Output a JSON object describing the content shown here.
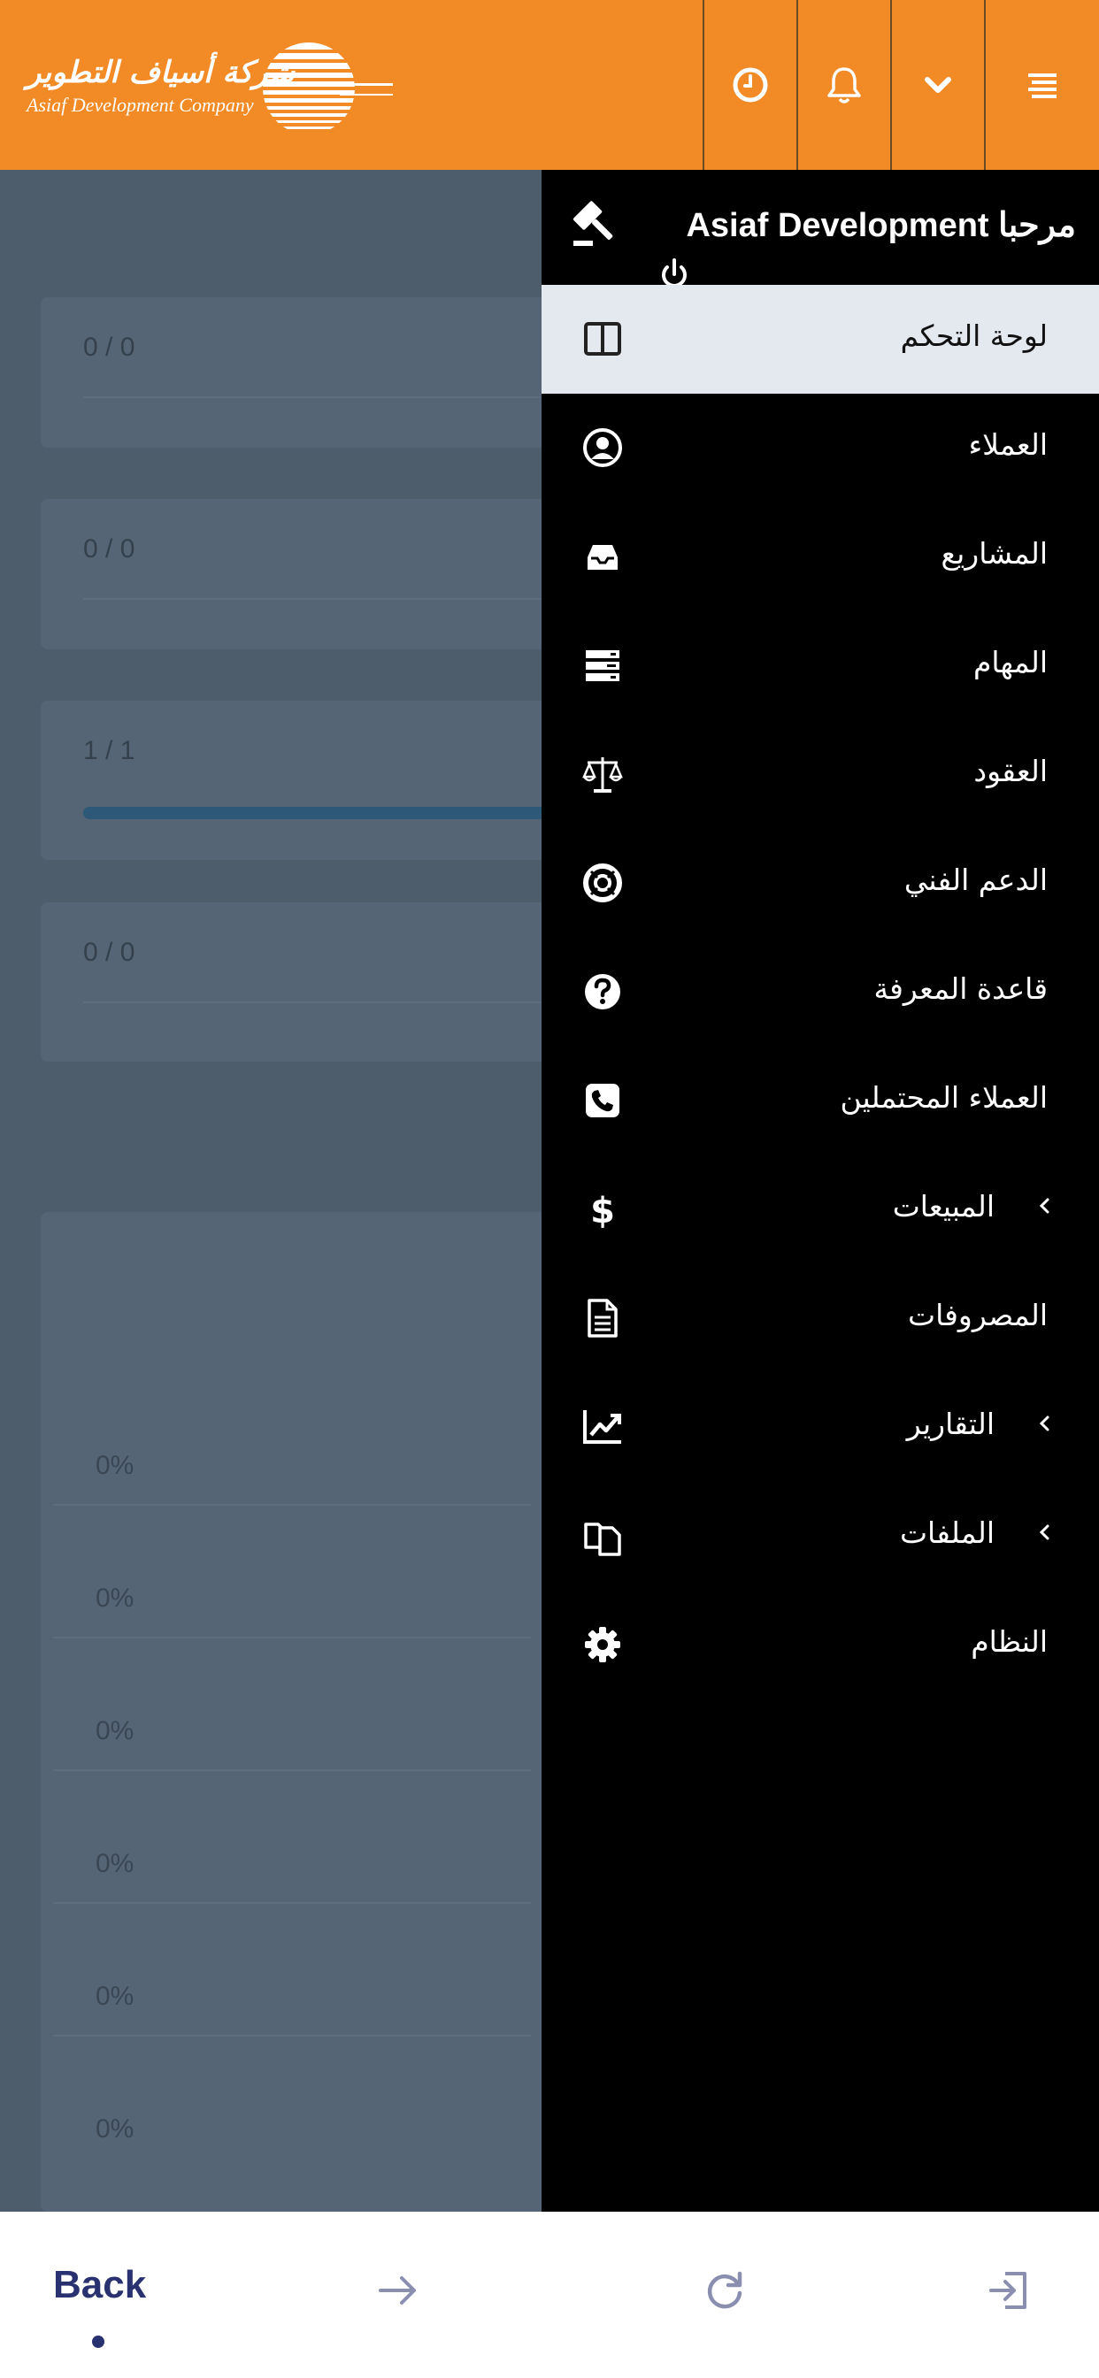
{
  "header": {
    "logo_arabic": "شركة أسياف التطوير",
    "logo_english": "Asiaf Development Company",
    "buttons": [
      "clock-icon",
      "bell-icon",
      "chevron-down-icon",
      "menu-icon"
    ],
    "accent": "#f28a25"
  },
  "background_cards": {
    "counters": [
      "0 / 0",
      "0 / 0",
      "1 / 1",
      "0 / 0"
    ],
    "progress": [
      0,
      0,
      1,
      0
    ],
    "percentages": [
      "0%",
      "0%",
      "0%",
      "0%",
      "0%",
      "0%"
    ]
  },
  "drawer": {
    "welcome": "مرحبا Asiaf Development",
    "items": [
      {
        "label": "لوحة التحكم",
        "icon": "columns-icon",
        "active": true,
        "has_submenu": false
      },
      {
        "label": "العملاء",
        "icon": "user-circle-icon",
        "active": false,
        "has_submenu": false
      },
      {
        "label": "المشاريع",
        "icon": "inbox-icon",
        "active": false,
        "has_submenu": false
      },
      {
        "label": "المهام",
        "icon": "tasks-icon",
        "active": false,
        "has_submenu": false
      },
      {
        "label": "العقود",
        "icon": "scale-icon",
        "active": false,
        "has_submenu": false
      },
      {
        "label": "الدعم الفني",
        "icon": "life-ring-icon",
        "active": false,
        "has_submenu": false
      },
      {
        "label": "قاعدة المعرفة",
        "icon": "question-circle-icon",
        "active": false,
        "has_submenu": false
      },
      {
        "label": "العملاء المحتملين",
        "icon": "phone-icon",
        "active": false,
        "has_submenu": false
      },
      {
        "label": "المبيعات",
        "icon": "dollar-icon",
        "active": false,
        "has_submenu": true
      },
      {
        "label": "المصروفات",
        "icon": "file-text-icon",
        "active": false,
        "has_submenu": false
      },
      {
        "label": "التقارير",
        "icon": "line-chart-icon",
        "active": false,
        "has_submenu": true
      },
      {
        "label": "الملفات",
        "icon": "files-icon",
        "active": false,
        "has_submenu": true
      },
      {
        "label": "النظام",
        "icon": "gear-icon",
        "active": false,
        "has_submenu": false
      }
    ]
  },
  "bottom_nav": {
    "back_label": "Back",
    "icons": [
      "arrow-right-icon",
      "refresh-icon",
      "exit-icon"
    ]
  }
}
